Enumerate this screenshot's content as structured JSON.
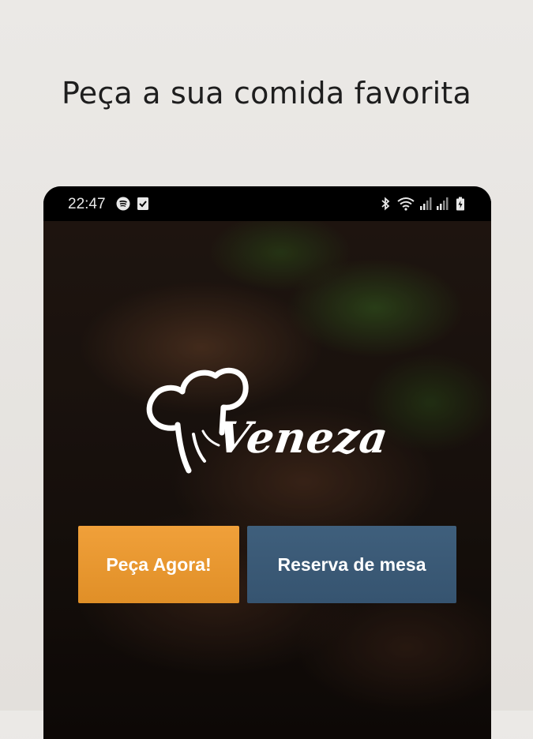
{
  "headline": "Peça a sua comida favorita",
  "status_bar": {
    "time": "22:47",
    "icons": [
      "spotify-icon",
      "checkbox-notification-icon",
      "bluetooth-icon",
      "wifi-icon",
      "signal-icon",
      "signal-icon-2",
      "battery-icon"
    ]
  },
  "app": {
    "logo_text": "Veneza",
    "buttons": {
      "order_label": "Peça Agora!",
      "reserve_label": "Reserva de mesa"
    }
  },
  "colors": {
    "order_button": "#e8962f",
    "reserve_button": "#3a5a76",
    "background": "#e8e6e3"
  }
}
